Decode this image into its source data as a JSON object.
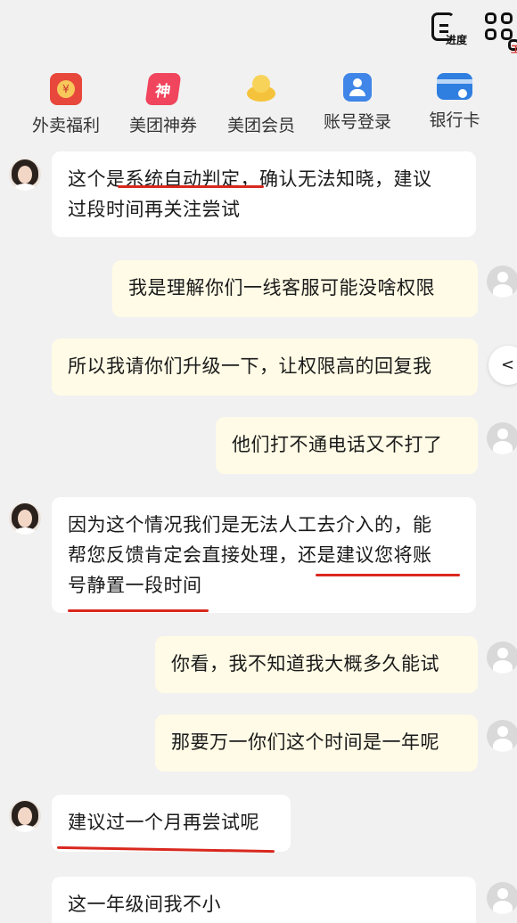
{
  "top": {
    "progress_label": "进度",
    "tool_label": "工具"
  },
  "shortcuts": [
    {
      "label": "外卖福利",
      "icon": "red-packet-icon",
      "color": "#e8483b"
    },
    {
      "label": "美团神券",
      "icon": "coupon-icon",
      "color": "#f0455c"
    },
    {
      "label": "美团会员",
      "icon": "member-crown-icon",
      "color": "#f5c33b"
    },
    {
      "label": "账号登录",
      "icon": "account-login-icon",
      "color": "#3f86e8"
    },
    {
      "label": "银行卡",
      "icon": "bank-card-icon",
      "color": "#2f7fe0"
    }
  ],
  "messages": [
    {
      "sender": "agent",
      "lines": [
        "这个是系统自动判定，确认无法知晓，建议",
        "过段时间再关注尝试"
      ]
    },
    {
      "sender": "user",
      "lines": [
        "我是理解你们一线客服可能没啥权限"
      ]
    },
    {
      "sender": "user",
      "lines": [
        "所以我请你们升级一下，让权限高的回复我"
      ]
    },
    {
      "sender": "user",
      "lines": [
        "他们打不通电话又不打了"
      ]
    },
    {
      "sender": "agent",
      "lines": [
        "因为这个情况我们是无法人工去介入的，能",
        "帮您反馈肯定会直接处理，还是建议您将账",
        "号静置一段时间"
      ]
    },
    {
      "sender": "user",
      "lines": [
        "你看，我不知道我大概多久能试"
      ]
    },
    {
      "sender": "user",
      "lines": [
        "那要万一你们这个时间是一年呢"
      ]
    },
    {
      "sender": "agent",
      "lines": [
        "建议过一个月再尝试呢"
      ]
    },
    {
      "sender": "user",
      "lines": [
        "这一年级间我不小"
      ]
    }
  ],
  "side_button": "<",
  "colors": {
    "annotation_red": "#d9281e",
    "user_bubble": "#fffbe6",
    "agent_bubble": "#ffffff"
  }
}
